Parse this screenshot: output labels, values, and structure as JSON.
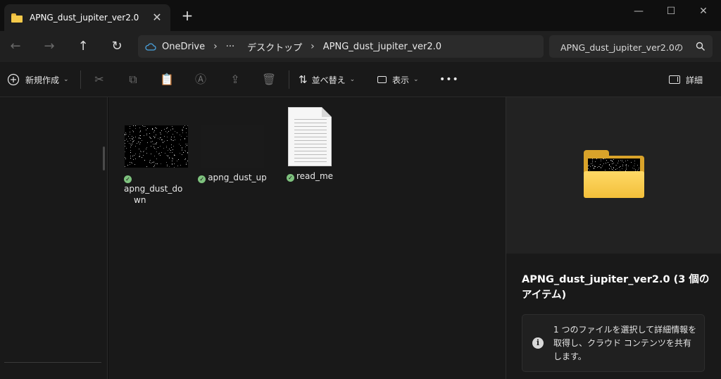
{
  "window": {
    "tab_title": "APNG_dust_jupiter_ver2.0",
    "tab_close": "✕",
    "new_tab": "+",
    "controls": {
      "minimize": "—",
      "maximize": "☐",
      "close": "✕"
    }
  },
  "nav": {
    "back": "←",
    "forward": "→",
    "up": "↑",
    "refresh": "↻"
  },
  "breadcrumb": {
    "root": "OneDrive",
    "more": "···",
    "items": [
      "デスクトップ",
      "APNG_dust_jupiter_ver2.0"
    ],
    "separator": "›"
  },
  "search": {
    "placeholder": "APNG_dust_jupiter_ver2.0の",
    "icon": "search-icon"
  },
  "toolbar": {
    "new_label": "新規作成",
    "sort_label": "並べ替え",
    "view_label": "表示",
    "more": "•••",
    "details_label": "詳細"
  },
  "files": [
    {
      "name": "apng_dust_down",
      "line1": "apng_dust_do",
      "line2": "wn",
      "kind": "dust-image"
    },
    {
      "name": "apng_dust_up",
      "line1": "apng_dust_up",
      "kind": "dust-image-dark"
    },
    {
      "name": "read_me",
      "line1": "read_me",
      "kind": "text-document"
    }
  ],
  "details": {
    "title": "APNG_dust_jupiter_ver2.0 (3 個のアイテム)",
    "info": "1 つのファイルを選択して詳細情報を取得し、クラウド コンテンツを共有します。",
    "info_icon": "i"
  },
  "colors": {
    "folder_front": "#f5c94a",
    "folder_back": "#d9a32a",
    "sync_ok": "#7ec27e",
    "background": "#191919"
  }
}
